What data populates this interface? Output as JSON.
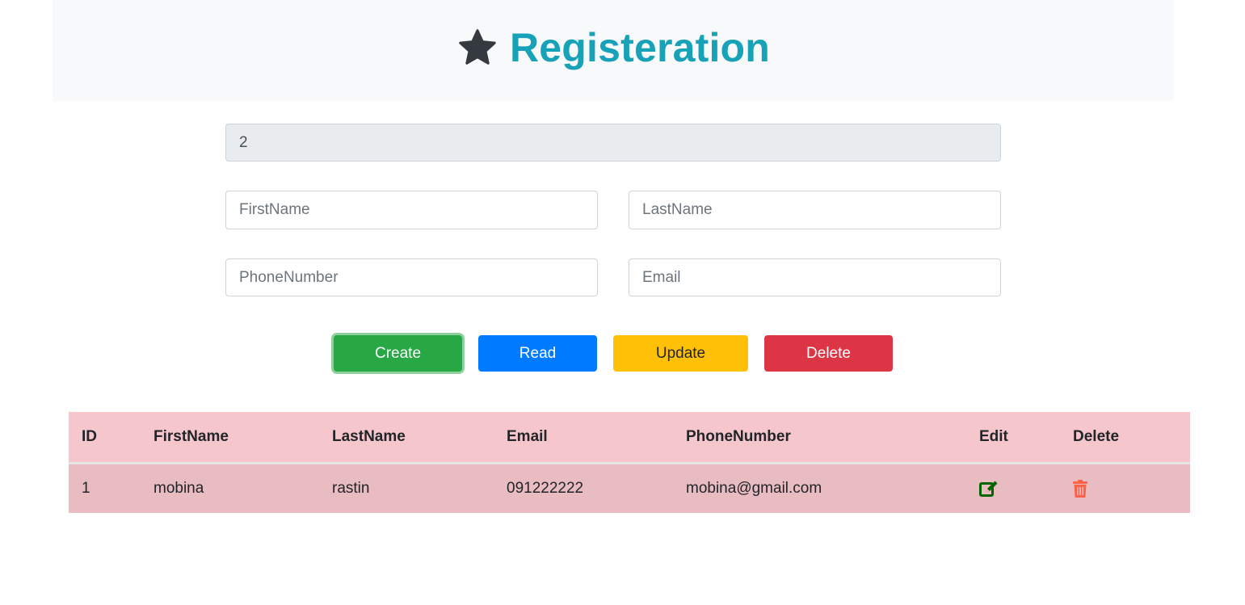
{
  "header": {
    "title": "Registeration",
    "icon": "star-icon",
    "title_color": "#17a2b8"
  },
  "form": {
    "id_value": "2",
    "firstname_placeholder": "FirstName",
    "lastname_placeholder": "LastName",
    "phone_placeholder": "PhoneNumber",
    "email_placeholder": "Email"
  },
  "buttons": {
    "create": "Create",
    "read": "Read",
    "update": "Update",
    "delete": "Delete"
  },
  "table": {
    "headers": [
      "ID",
      "FirstName",
      "LastName",
      "Email",
      "PhoneNumber",
      "Edit",
      "Delete"
    ],
    "rows": [
      {
        "id": "1",
        "firstname": "mobina",
        "lastname": "rastin",
        "email": "091222222",
        "phone": "mobina@gmail.com",
        "edit_icon": "edit-icon",
        "delete_icon": "trash-icon"
      }
    ],
    "edit_icon_color": "#006400",
    "delete_icon_color": "#ff6347"
  }
}
